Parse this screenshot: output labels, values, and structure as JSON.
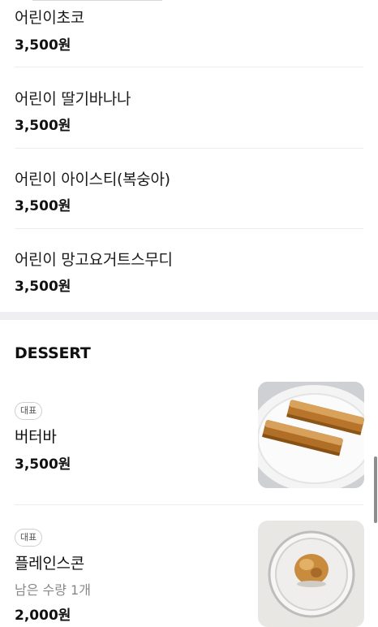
{
  "drinks": [
    {
      "name": "어린이초코",
      "price": "3,500원"
    },
    {
      "name": "어린이 딸기바나나",
      "price": "3,500원"
    },
    {
      "name": "어린이 아이스티(복숭아)",
      "price": "3,500원"
    },
    {
      "name": "어린이 망고요거트스무디",
      "price": "3,500원"
    }
  ],
  "dessert": {
    "title": "DESSERT",
    "items": [
      {
        "badge": "대표",
        "name": "버터바",
        "price": "3,500원",
        "image": "butter-bar-photo"
      },
      {
        "badge": "대표",
        "name": "플레인스콘",
        "stock": "남은 수량 1개",
        "price": "2,000원",
        "image": "plain-scone-photo"
      }
    ]
  }
}
